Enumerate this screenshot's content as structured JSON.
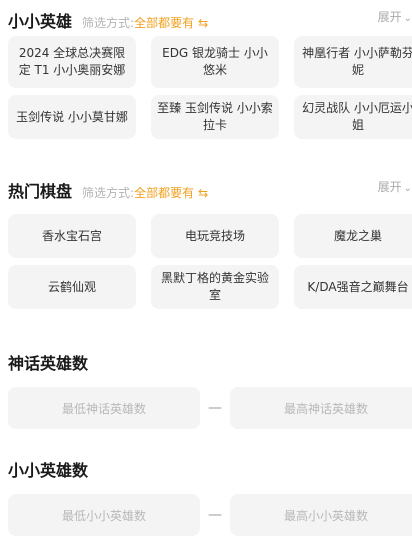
{
  "heroes": {
    "title": "小小英雄",
    "filter_label": "筛选方式:",
    "filter_value": "全部都要有",
    "swap_icon": "⇆",
    "expand_label": "展开",
    "items": [
      "2024 全球总决赛限定 T1 小小奥丽安娜",
      "EDG 银龙骑士 小小悠米",
      "神凰行者 小小萨勒芬妮",
      "玉剑传说 小小莫甘娜",
      "至臻 玉剑传说 小小索拉卡",
      "幻灵战队 小小厄运小姐"
    ]
  },
  "boards": {
    "title": "热门棋盘",
    "filter_label": "筛选方式:",
    "filter_value": "全部都要有",
    "swap_icon": "⇆",
    "expand_label": "展开",
    "items": [
      "香水宝石宫",
      "电玩竞技场",
      "魔龙之巢",
      "云鹤仙观",
      "黑默丁格的黄金实验室",
      "K/DA强音之巅舞台"
    ]
  },
  "myth_count": {
    "title": "神话英雄数",
    "min_placeholder": "最低神话英雄数",
    "max_placeholder": "最高神话英雄数",
    "separator": "—"
  },
  "small_count": {
    "title": "小小英雄数",
    "min_placeholder": "最低小小英雄数",
    "max_placeholder": "最高小小英雄数",
    "separator": "—"
  }
}
